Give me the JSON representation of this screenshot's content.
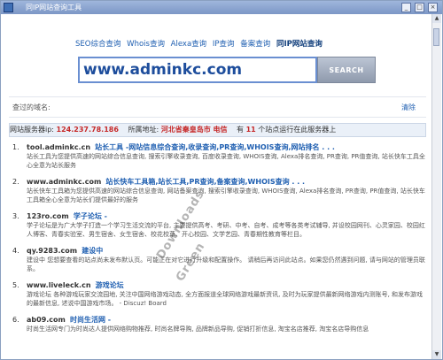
{
  "window": {
    "title": "同IP网站查询工具",
    "controls": [
      "_",
      "□",
      "×"
    ]
  },
  "tabs": [
    {
      "label": "SEO综合查询",
      "active": false
    },
    {
      "label": "Whois查询",
      "active": false
    },
    {
      "label": "Alexa查询",
      "active": false
    },
    {
      "label": "IP查询",
      "active": false
    },
    {
      "label": "备案查询",
      "active": false
    },
    {
      "label": "同IP网站查询",
      "active": true
    }
  ],
  "search": {
    "value": "www.adminkc.com",
    "button": "SEARCH"
  },
  "queried": {
    "label": "查过的域名:",
    "clear": "清除"
  },
  "server": {
    "ip_label": "网站服务器ip:",
    "ip": "124.237.78.186",
    "loc_label": "所属地址:",
    "loc": "河北省秦皇岛市 电信",
    "count_pre": "有",
    "count": "11",
    "count_post": "个站点运行在此服务器上"
  },
  "results": [
    {
      "num": "1.",
      "domain": "tool.adminkc.cn",
      "title": "站长工具 -网站信息综合查询,收录查询,PR查询,WHOIS查询,网站排名 . . .",
      "desc": "站长工具为您提供高速的网站综合信息查询, 搜索引擎收录查询, 百度收录查询, WHOIS查询, Alexa排名查询, PR查询, PR值查询, 站长快车工具全心全意为站长服务"
    },
    {
      "num": "2.",
      "domain": "www.adminkc.com",
      "title": "站长快车工具箱,站长工具,PR查询,备案查询,WHOIS查询 . . .",
      "desc": "站长快车工具箱为您提供高速的网站综合信息查询, 网站备案查询, 搜索引擎收录查询, WHOIS查询, Alexa排名查询, PR查询, PR值查询, 站长快车工具箱全心全意为站长们提供最好的服务"
    },
    {
      "num": "3.",
      "domain": "123ro.com",
      "title": "学子论坛 -",
      "desc": "学子论坛是为广大学子打造一个学习生活交流的平台, 主要提供高考、考研、中考、自考、成考等各类考试辅导, 并设校园网刊、心灵家园、校园红人博客、青春实验室、男生宿舍、女生宿舍、校花校草、开心校园、文学艺园、青春期性教育等栏目。"
    },
    {
      "num": "4.",
      "domain": "qy.9283.com",
      "title": "建设中",
      "desc": "建设中 您想要查看的站点尚未发布默认页。可能正在对它进行升级和配置操作。 请稍后再访问此站点。如果您仍然遇到问题, 请与网站的管理员联系。"
    },
    {
      "num": "5.",
      "domain": "www.liveleck.cn",
      "title": "游戏论坛",
      "desc": "游戏论坛 各种游戏玩家交流园地, 关注中国网络游戏动态, 全方面报道全球网络游戏最新资讯, 及时为玩家提供最新网络游戏内测账号, 和发布游戏的最新信息, 述说中国游戏市场。 - Discuz! Board"
    },
    {
      "num": "6.",
      "domain": "ab09.com",
      "title": "时尚生活网 -",
      "desc": "时尚生活网专门为时尚达人提供网络购物推荐, 时尚名牌导购, 品牌新品导购, 促销打折信息, 淘宝名店推荐, 淘宝名店导购信息"
    }
  ],
  "watermark": {
    "line1": "Downloads",
    "line2": "Green"
  }
}
